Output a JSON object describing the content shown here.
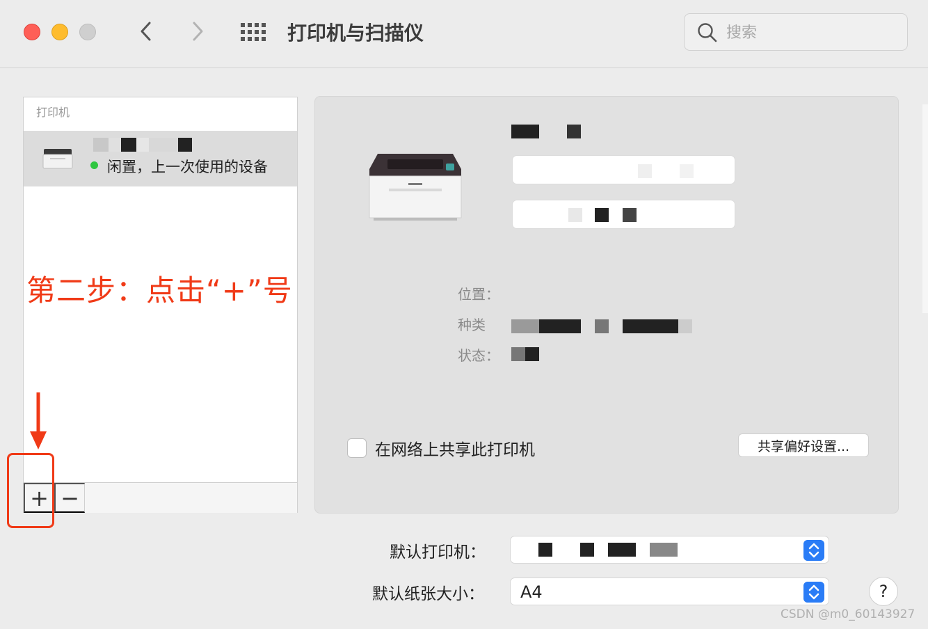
{
  "window": {
    "title": "打印机与扫描仪"
  },
  "toolbar": {
    "back_icon": "chevron-left-icon",
    "forward_icon": "chevron-right-icon",
    "grid_icon": "grid-icon",
    "search_placeholder": "搜索"
  },
  "sidebar": {
    "header": "打印机",
    "printers": [
      {
        "status": "闲置，上一次使用的设备",
        "status_color": "#2fc640"
      }
    ],
    "add_label": "+",
    "remove_label": "−"
  },
  "annotation": {
    "text": "第二步：点击“+”号",
    "color": "#f03a17"
  },
  "detail": {
    "location_label": "位置：",
    "kind_label": "种类",
    "status_label": "状态：",
    "share_label": "在网络上共享此打印机",
    "share_prefs_label": "共享偏好设置..."
  },
  "defaults": {
    "printer_label": "默认打印机：",
    "paper_label": "默认纸张大小：",
    "paper_value": "A4"
  },
  "help_label": "?",
  "watermark": "CSDN @m0_60143927"
}
